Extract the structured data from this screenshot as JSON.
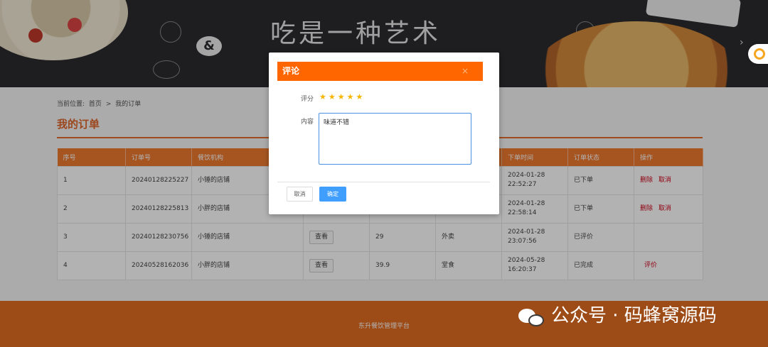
{
  "banner": {
    "title": "吃是一种艺术",
    "amp": "&",
    "arrow": "›"
  },
  "breadcrumb": {
    "label": "当前位置:",
    "home": "首页",
    "sep": ">",
    "current": "我的订单"
  },
  "page_title": "我的订单",
  "table": {
    "headers": [
      "序号",
      "订单号",
      "餐饮机构",
      "",
      "",
      "",
      "下单时间",
      "订单状态",
      "操作"
    ],
    "rows": [
      {
        "no": "1",
        "order": "20240128225227",
        "shop": "小锤的店铺",
        "view": "",
        "price": "",
        "type": "",
        "time": "2024-01-28 22:52:27",
        "status": "已下单",
        "act1": "删除",
        "act2": "取消"
      },
      {
        "no": "2",
        "order": "20240128225813",
        "shop": "小胖的店铺",
        "view": "",
        "price": "",
        "type": "",
        "time": "2024-01-28 22:58:14",
        "status": "已下单",
        "act1": "删除",
        "act2": "取消"
      },
      {
        "no": "3",
        "order": "20240128230756",
        "shop": "小锤的店铺",
        "view": "查看",
        "price": "29",
        "type": "外卖",
        "time": "2024-01-28 23:07:56",
        "status": "已评价",
        "act1": "",
        "act2": ""
      },
      {
        "no": "4",
        "order": "20240528162036",
        "shop": "小胖的店铺",
        "view": "查看",
        "price": "39.9",
        "type": "堂食",
        "time": "2024-05-28 16:20:37",
        "status": "已完成",
        "act1": "评价",
        "act2": ""
      }
    ]
  },
  "footer": {
    "text": "东升餐饮管理平台"
  },
  "dialog": {
    "title": "评论",
    "close": "×",
    "rating_label": "评分",
    "stars": "★★★★★",
    "content_label": "内容",
    "content_value": "味道不错",
    "cancel": "取消",
    "ok": "确定"
  },
  "watermark": {
    "text": "公众号 · 码蜂窝源码"
  },
  "colors": {
    "accent": "#ff6600",
    "primary_button": "#409eff",
    "star": "#f7b500",
    "danger": "#d0021b"
  }
}
